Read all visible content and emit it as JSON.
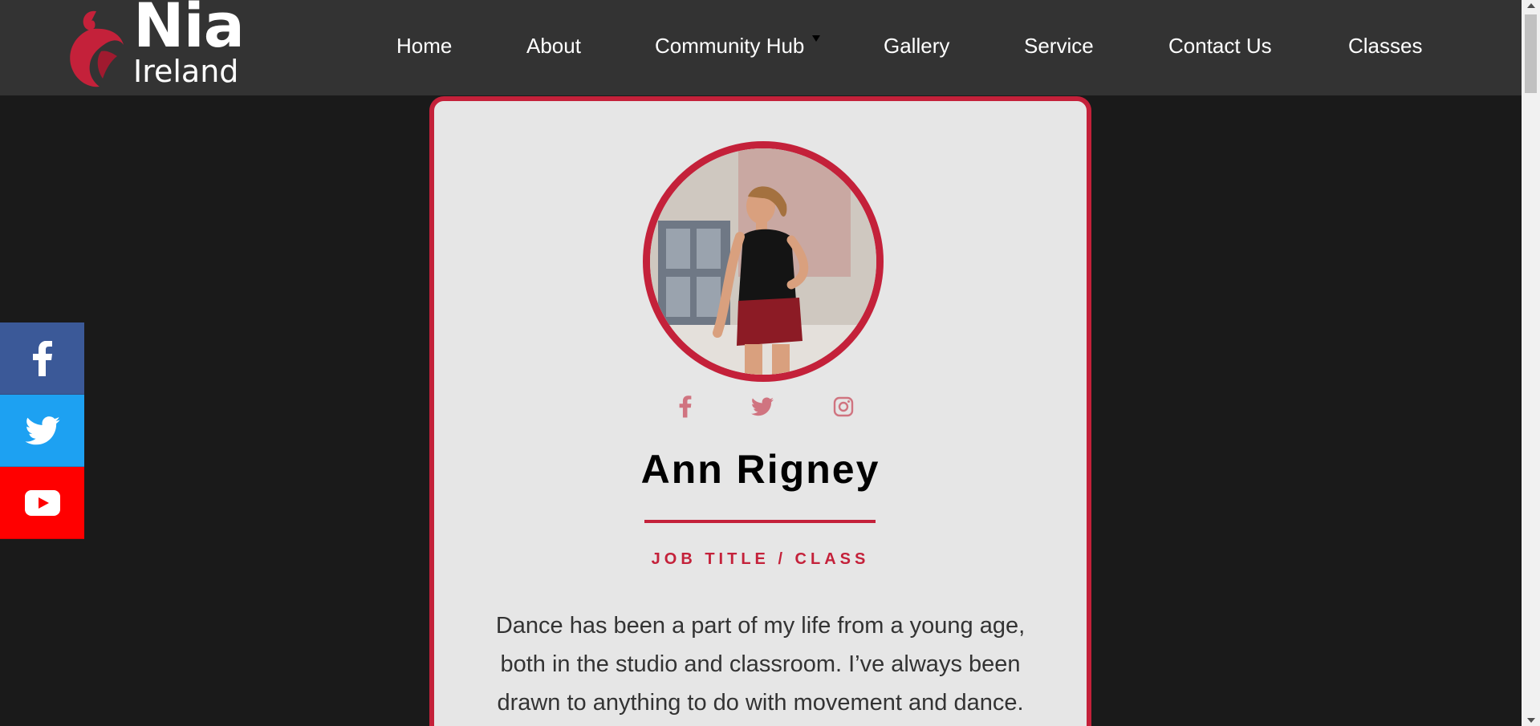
{
  "brand": {
    "name": "Nia",
    "sub": "Ireland",
    "accent": "#c4213a"
  },
  "nav": [
    {
      "label": "Home"
    },
    {
      "label": "About"
    },
    {
      "label": "Community Hub"
    },
    {
      "label": "Gallery"
    },
    {
      "label": "Service"
    },
    {
      "label": "Contact Us"
    },
    {
      "label": "Classes"
    }
  ],
  "social_sidebar": [
    {
      "icon": "facebook-icon",
      "color": "#3b5998"
    },
    {
      "icon": "twitter-icon",
      "color": "#1da1f2"
    },
    {
      "icon": "youtube-icon",
      "color": "#ff0000"
    }
  ],
  "profile": {
    "name": "Ann Rigney",
    "job_title": "JOB TITLE / CLASS",
    "bio": "Dance has been a part of my life from a young age, both in the studio and classroom. I’ve always been drawn to anything to do with movement and dance.",
    "social_icons": [
      "facebook-icon",
      "twitter-icon",
      "instagram-icon"
    ]
  }
}
